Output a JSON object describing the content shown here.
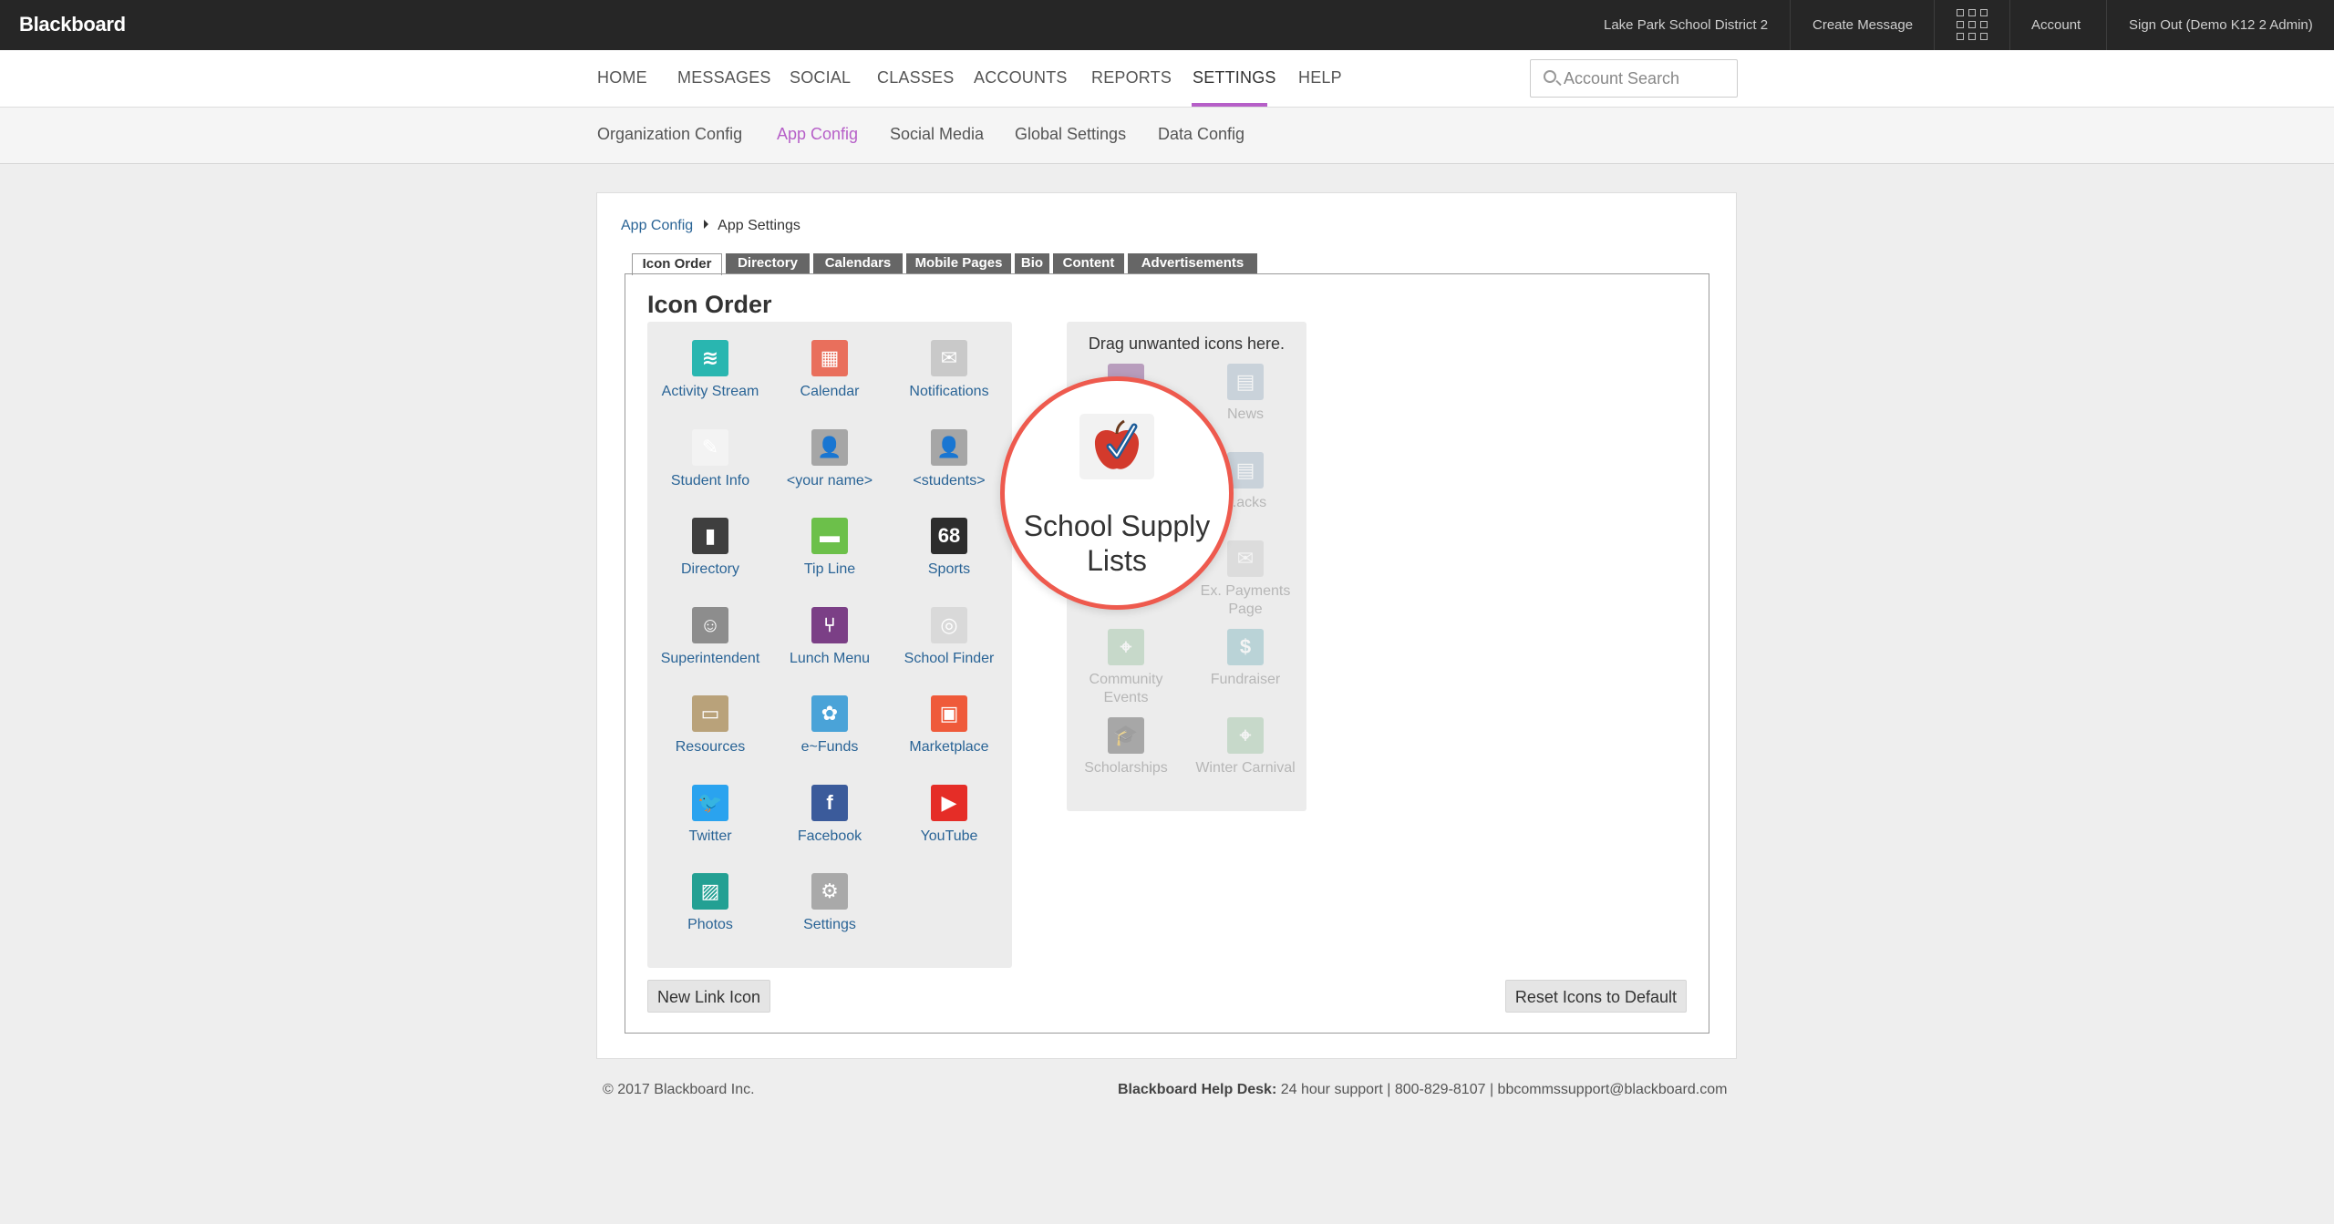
{
  "topbar": {
    "logo": "Blackboard",
    "district": "Lake Park School District 2",
    "create_message": "Create Message",
    "account": "Account",
    "sign_out": "Sign Out (Demo K12 2 Admin)"
  },
  "main_nav": {
    "items": [
      "HOME",
      "MESSAGES",
      "SOCIAL",
      "CLASSES",
      "ACCOUNTS",
      "REPORTS",
      "SETTINGS",
      "HELP"
    ],
    "active": "SETTINGS",
    "search_placeholder": "Account Search"
  },
  "sub_nav": {
    "items": [
      "Organization Config",
      "App Config",
      "Social Media",
      "Global Settings",
      "Data Config"
    ],
    "active": "App Config"
  },
  "breadcrumb": {
    "link": "App Config",
    "current": "App Settings"
  },
  "tabs": [
    "Icon Order",
    "Directory",
    "Calendars",
    "Mobile Pages",
    "Bio",
    "Content",
    "Advertisements"
  ],
  "section_title": "Icon Order",
  "icons": [
    {
      "label": "Activity Stream",
      "icon": "waves-icon",
      "color": "#29b6b0"
    },
    {
      "label": "Calendar",
      "icon": "calendar-icon",
      "color": "#e96f5c"
    },
    {
      "label": "Notifications",
      "icon": "envelope-icon",
      "color": "#c9c9c9"
    },
    {
      "label": "Student Info",
      "icon": "notepad-icon",
      "color": "#f3f3f3"
    },
    {
      "label": "<your name>",
      "icon": "person-icon",
      "color": "#a6a6a6"
    },
    {
      "label": "<students>",
      "icon": "person-icon",
      "color": "#a6a6a6"
    },
    {
      "label": "Directory",
      "icon": "book-icon",
      "color": "#3f3f3f"
    },
    {
      "label": "Tip Line",
      "icon": "speech-bubble-icon",
      "color": "#6cc04a"
    },
    {
      "label": "Sports",
      "icon": "scoreboard-icon",
      "color": "#2d2d2d"
    },
    {
      "label": "Superintendent",
      "icon": "person-portrait-icon",
      "color": "#8d8d8d"
    },
    {
      "label": "Lunch Menu",
      "icon": "fork-knife-icon",
      "color": "#7b3f86"
    },
    {
      "label": "School Finder",
      "icon": "compass-icon",
      "color": "#d9d9d9"
    },
    {
      "label": "Resources",
      "icon": "folder-icon",
      "color": "#b9a27a"
    },
    {
      "label": "e~Funds",
      "icon": "people-circle-icon",
      "color": "#4aa3d8"
    },
    {
      "label": "Marketplace",
      "icon": "shopping-bag-icon",
      "color": "#ef5a3a"
    },
    {
      "label": "Twitter",
      "icon": "twitter-icon",
      "color": "#2aa3ef"
    },
    {
      "label": "Facebook",
      "icon": "facebook-icon",
      "color": "#3b5b9b"
    },
    {
      "label": "YouTube",
      "icon": "youtube-icon",
      "color": "#e52d27"
    },
    {
      "label": "Photos",
      "icon": "photo-icon",
      "color": "#23a093"
    },
    {
      "label": "Settings",
      "icon": "gear-icon",
      "color": "#a9a9a9"
    }
  ],
  "unwanted": {
    "header": "Drag unwanted icons here.",
    "icons": [
      {
        "label": "",
        "icon": "purple-icon",
        "color": "#7b3f86"
      },
      {
        "label": "News",
        "icon": "newspaper-icon",
        "color": "#9fb4c6"
      },
      {
        "label": "",
        "icon": "grid-icon",
        "color": "#cfcfcf"
      },
      {
        "label": "...acks",
        "icon": "notes-icon",
        "color": "#9fb4c6"
      },
      {
        "label": "",
        "icon": "blank-icon",
        "color": "#ececec"
      },
      {
        "label": "Ex. Payments Page",
        "icon": "envelope-icon",
        "color": "#c9c9c9"
      },
      {
        "label": "Community Events",
        "icon": "map-pin-icon",
        "color": "#9cc3a3"
      },
      {
        "label": "Fundraiser",
        "icon": "money-icon",
        "color": "#7eb6bf"
      },
      {
        "label": "Scholarships",
        "icon": "graduation-cap-icon",
        "color": "#555555"
      },
      {
        "label": "Winter Carnival",
        "icon": "map-pin-icon",
        "color": "#9cc3a3"
      }
    ]
  },
  "spotlight": {
    "label": "School Supply Lists",
    "icon": "apple-check-icon",
    "ring_color": "#ee5a4e"
  },
  "buttons": {
    "new_link": "New Link Icon",
    "reset": "Reset Icons to Default"
  },
  "footer": {
    "copyright": "© 2017 Blackboard Inc.",
    "help_label": "Blackboard Help Desk:",
    "help_text": " 24 hour support  |  800-829-8107  |  bbcommssupport@blackboard.com"
  },
  "colors": {
    "accent": "#b65fc8",
    "link": "#2a6496",
    "topbar": "#262626"
  }
}
